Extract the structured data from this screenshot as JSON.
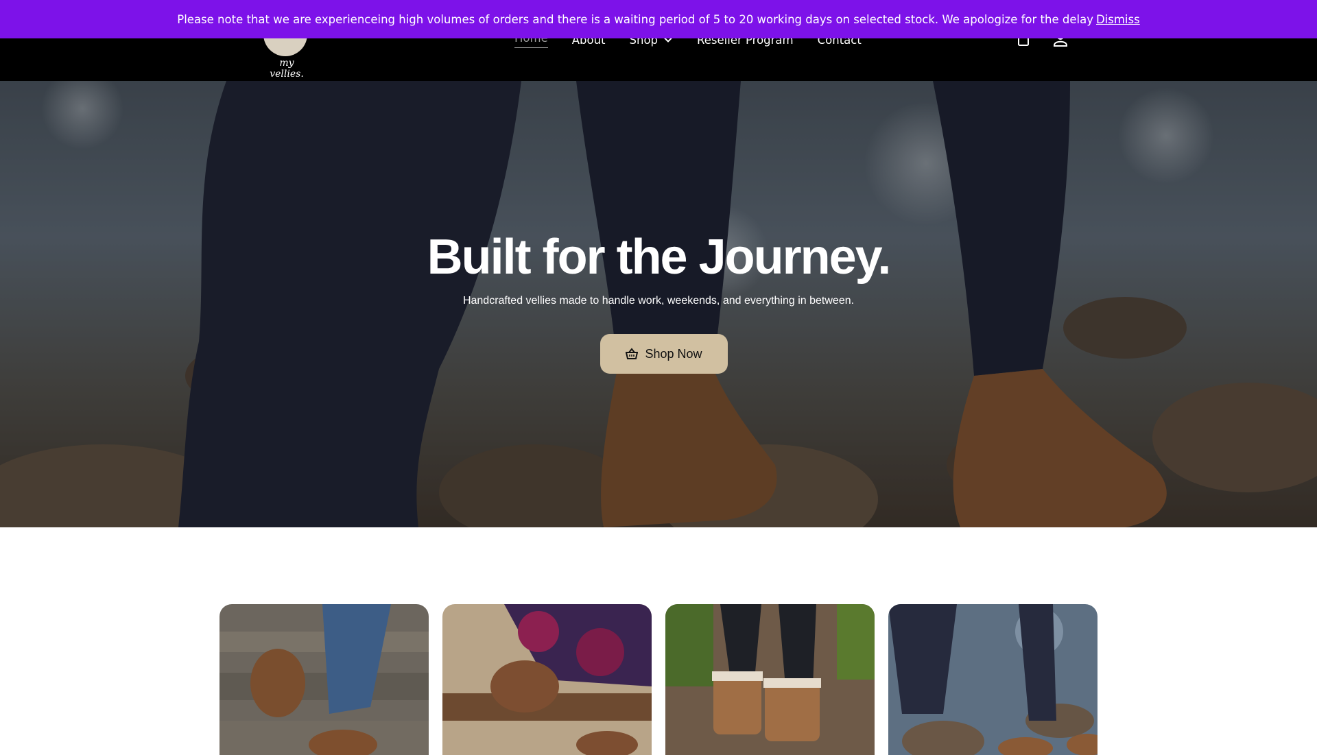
{
  "notice": {
    "text": "Please note that we are experienceing high volumes of orders and there is a waiting period of 5 to 20 working days on selected stock. We apologize for the delay",
    "dismiss": "Dismiss",
    "bg_color": "#7d12e9"
  },
  "header": {
    "logo_text": "my vellies.",
    "nav": [
      {
        "label": "Home"
      },
      {
        "label": "About"
      },
      {
        "label": "Shop"
      },
      {
        "label": "Reseller Program"
      },
      {
        "label": "Contact"
      }
    ],
    "icons": [
      "cart-icon",
      "account-icon"
    ]
  },
  "hero": {
    "title": "Built for the Journey.",
    "subtitle": "Handcrafted vellies made to handle work, weekends, and everything in between.",
    "cta": "Shop Now",
    "cta_color": "#d1c0a1",
    "cta_icon": "basket-icon"
  },
  "cards": [
    {
      "name": "card-1"
    },
    {
      "name": "card-2"
    },
    {
      "name": "card-3"
    },
    {
      "name": "card-4"
    }
  ]
}
